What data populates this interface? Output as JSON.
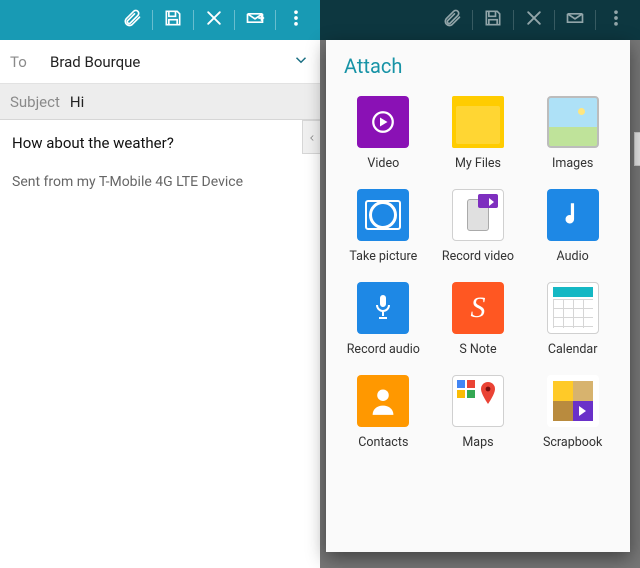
{
  "toolbar": {
    "attach": "attach-icon",
    "save": "save-icon",
    "discard": "close-icon",
    "send": "send-icon",
    "more": "more-icon"
  },
  "compose": {
    "to_label": "To",
    "to_value": "Brad Bourque",
    "subject_label": "Subject",
    "subject_value": "Hi",
    "body": "How about the weather?",
    "signature": "Sent from my T-Mobile 4G LTE Device"
  },
  "attach_panel": {
    "title": "Attach",
    "items": [
      {
        "label": "Video",
        "icon": "video-icon"
      },
      {
        "label": "My Files",
        "icon": "folder-icon"
      },
      {
        "label": "Images",
        "icon": "images-icon"
      },
      {
        "label": "Take picture",
        "icon": "camera-icon"
      },
      {
        "label": "Record video",
        "icon": "camcorder-icon"
      },
      {
        "label": "Audio",
        "icon": "music-note-icon"
      },
      {
        "label": "Record audio",
        "icon": "microphone-icon"
      },
      {
        "label": "S Note",
        "icon": "snote-icon"
      },
      {
        "label": "Calendar",
        "icon": "calendar-icon"
      },
      {
        "label": "Contacts",
        "icon": "contacts-icon"
      },
      {
        "label": "Maps",
        "icon": "maps-icon"
      },
      {
        "label": "Scrapbook",
        "icon": "scrapbook-icon"
      }
    ]
  },
  "colors": {
    "accent": "#189ab4",
    "accent_dim": "#0d3740",
    "panel_title": "#1793a6"
  }
}
